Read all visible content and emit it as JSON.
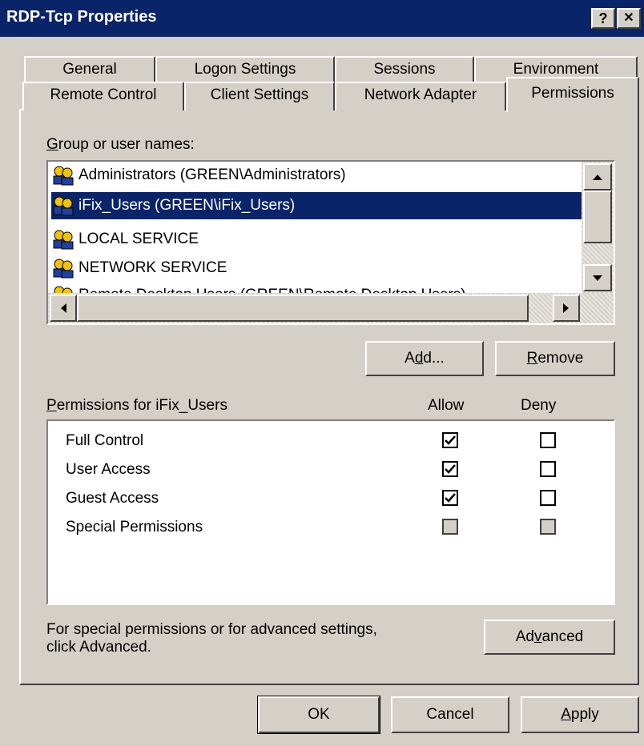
{
  "window": {
    "title": "RDP-Tcp Properties",
    "help_label": "?",
    "close_label": "✕"
  },
  "tabs_back": [
    {
      "label": "General"
    },
    {
      "label": "Logon Settings"
    },
    {
      "label": "Sessions"
    },
    {
      "label": "Environment"
    }
  ],
  "tabs_front": [
    {
      "label": "Remote Control"
    },
    {
      "label": "Client Settings"
    },
    {
      "label": "Network Adapter"
    },
    {
      "label": "Permissions",
      "selected": true
    }
  ],
  "groups": {
    "label_access": "G",
    "label_rest": "roup or user names:",
    "items": [
      {
        "name": "Administrators (GREEN\\Administrators)",
        "selected": false
      },
      {
        "name": "iFix_Users (GREEN\\iFix_Users)",
        "selected": true
      },
      {
        "name": "LOCAL SERVICE",
        "selected": false
      },
      {
        "name": "NETWORK SERVICE",
        "selected": false
      },
      {
        "name": "Remote Desktop Users (GREEN\\Remote Desktop Users)",
        "selected": false
      }
    ]
  },
  "buttons": {
    "add_pre": "A",
    "add_access": "d",
    "add_post": "d...",
    "remove_access": "R",
    "remove_post": "emove",
    "advanced_pre": "Ad",
    "advanced_access": "v",
    "advanced_post": "anced",
    "ok": "OK",
    "cancel": "Cancel",
    "apply_access": "A",
    "apply_post": "pply"
  },
  "permissions": {
    "label_access": "P",
    "label_rest": "ermissions for iFix_Users",
    "allow_header": "Allow",
    "deny_header": "Deny",
    "rows": [
      {
        "name": "Full Control",
        "allow": true,
        "deny": false,
        "disabled": false
      },
      {
        "name": "User Access",
        "allow": true,
        "deny": false,
        "disabled": false
      },
      {
        "name": "Guest Access",
        "allow": true,
        "deny": false,
        "disabled": false
      },
      {
        "name": "Special Permissions",
        "allow": false,
        "deny": false,
        "disabled": true
      }
    ]
  },
  "advanced_note": {
    "line1": "For special permissions or for advanced settings,",
    "line2": "click Advanced."
  },
  "colors": {
    "selection": "#0a246a",
    "face": "#d4d0c8"
  }
}
